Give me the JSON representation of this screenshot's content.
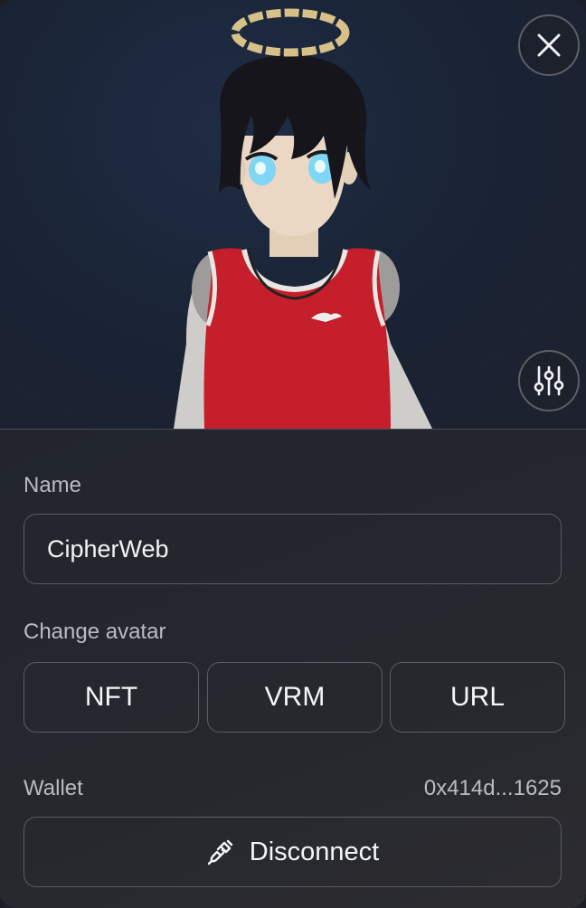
{
  "form": {
    "name_label": "Name",
    "name_value": "CipherWeb",
    "change_avatar_label": "Change avatar",
    "avatar_options": [
      "NFT",
      "VRM",
      "URL"
    ],
    "wallet_label": "Wallet",
    "wallet_address": "0x414d...1625",
    "disconnect_label": "Disconnect"
  },
  "icons": {
    "close": "close-icon",
    "settings": "sliders-icon",
    "disconnect": "unplug-icon"
  },
  "colors": {
    "jersey": "#c41f2a",
    "hair": "#15151b",
    "eyes": "#7fd6f5",
    "halo": "#d8c089"
  }
}
